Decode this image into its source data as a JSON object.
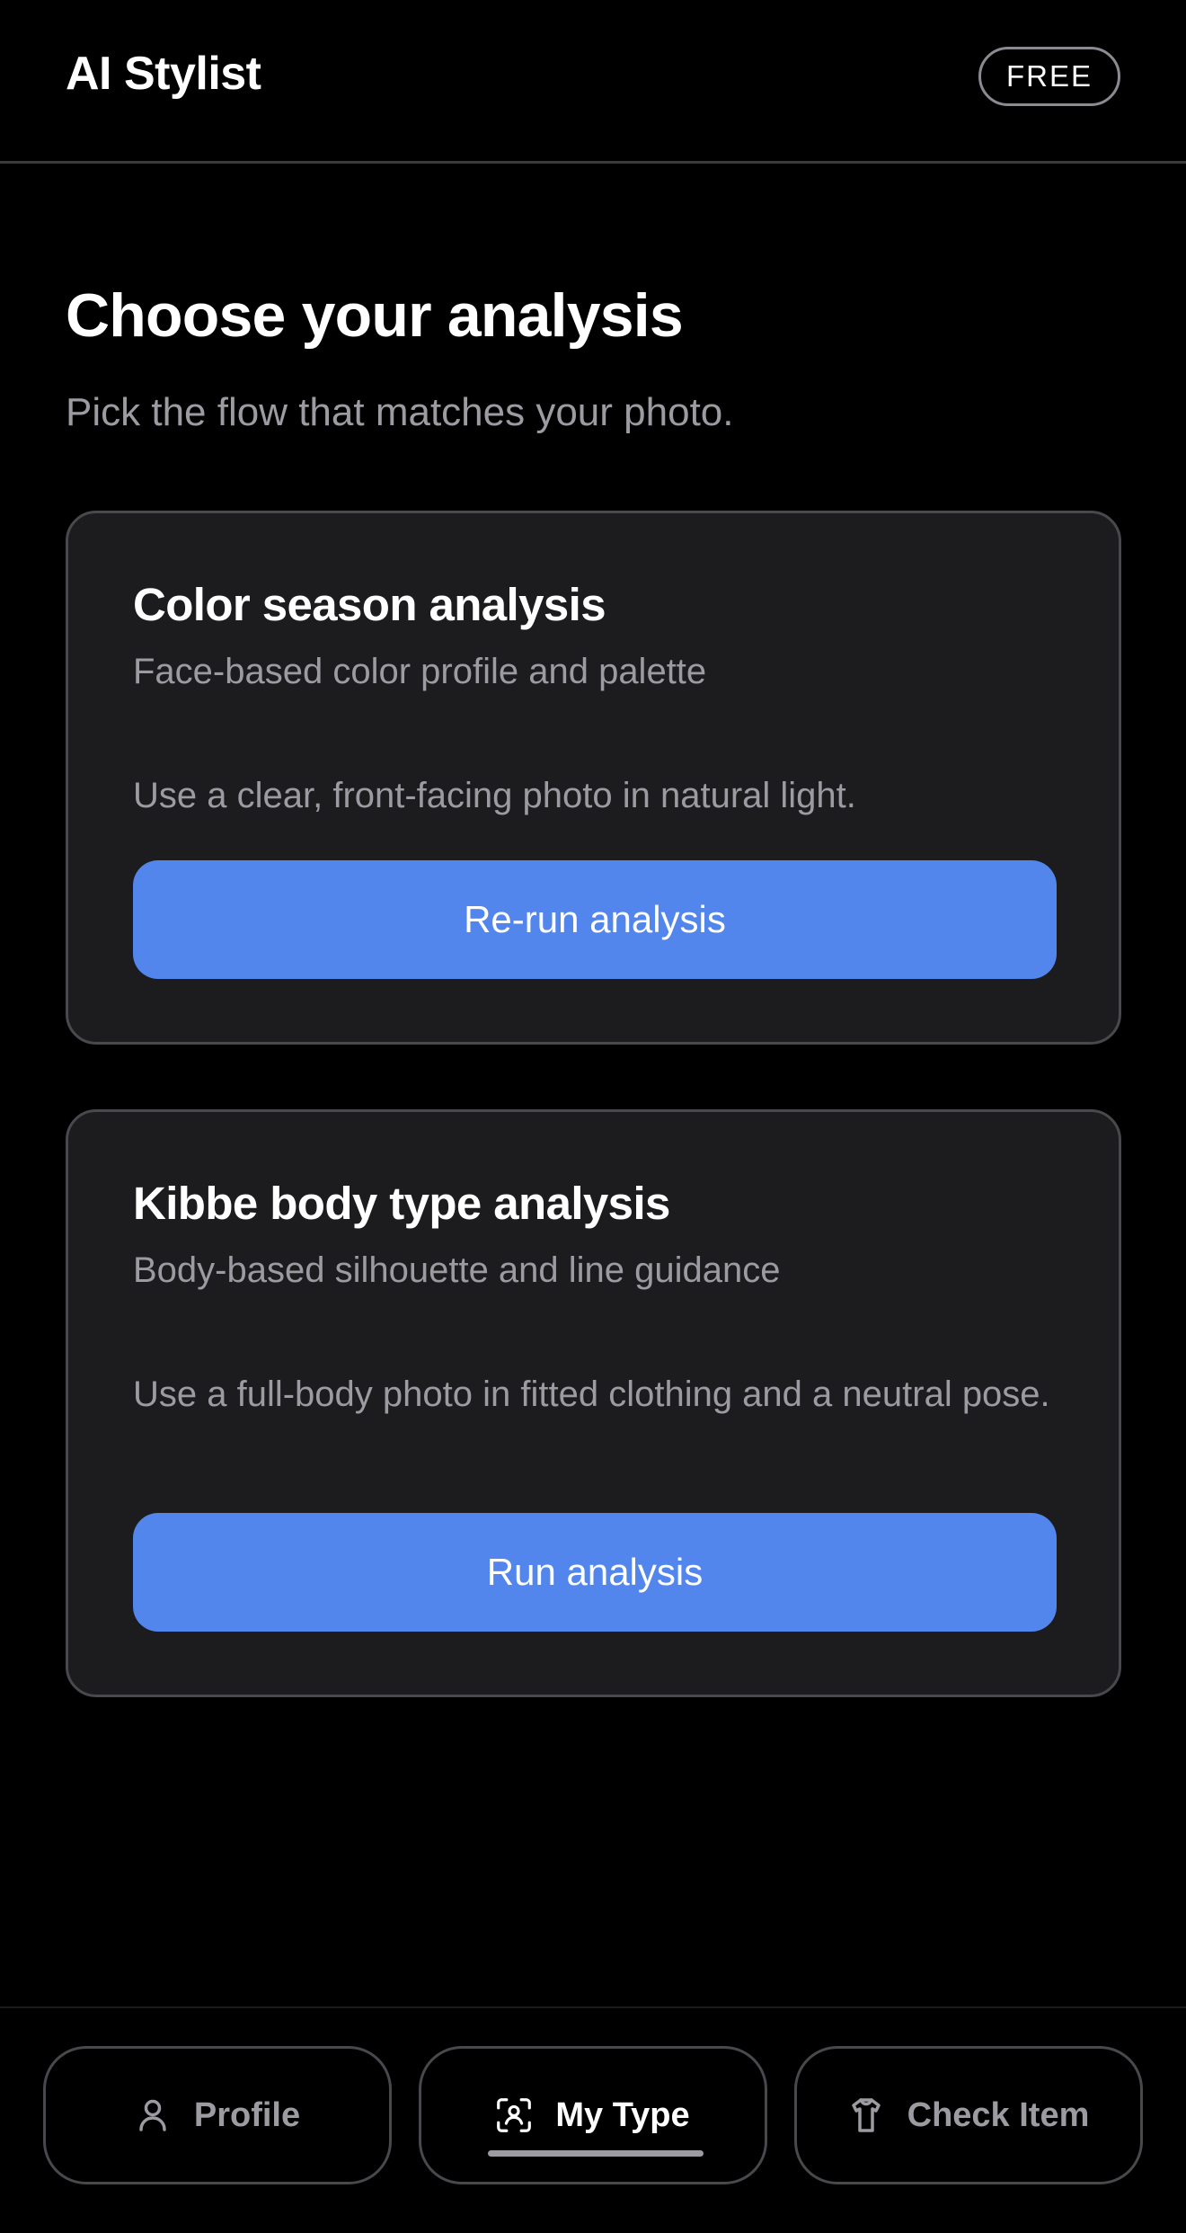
{
  "header": {
    "title": "AI Stylist",
    "plan_badge": "FREE"
  },
  "main": {
    "title": "Choose your analysis",
    "subtitle": "Pick the flow that matches your photo.",
    "cards": [
      {
        "title": "Color season analysis",
        "subtitle": "Face-based color profile and palette",
        "hint": "Use a clear, front-facing photo in natural light.",
        "button_label": "Re-run analysis"
      },
      {
        "title": "Kibbe body type analysis",
        "subtitle": "Body-based silhouette and line guidance",
        "hint": "Use a full-body photo in fitted clothing and a neutral pose.",
        "button_label": "Run analysis"
      }
    ]
  },
  "bottom_nav": {
    "active": "My Type",
    "items": [
      {
        "label": "Profile",
        "icon": "person-icon"
      },
      {
        "label": "My Type",
        "icon": "face-scan-icon"
      },
      {
        "label": "Check Item",
        "icon": "shirt-icon"
      }
    ]
  },
  "colors": {
    "background": "#000000",
    "card": "#1c1c1f",
    "accent": "#5286ed",
    "muted_text": "#9b9ba1"
  }
}
